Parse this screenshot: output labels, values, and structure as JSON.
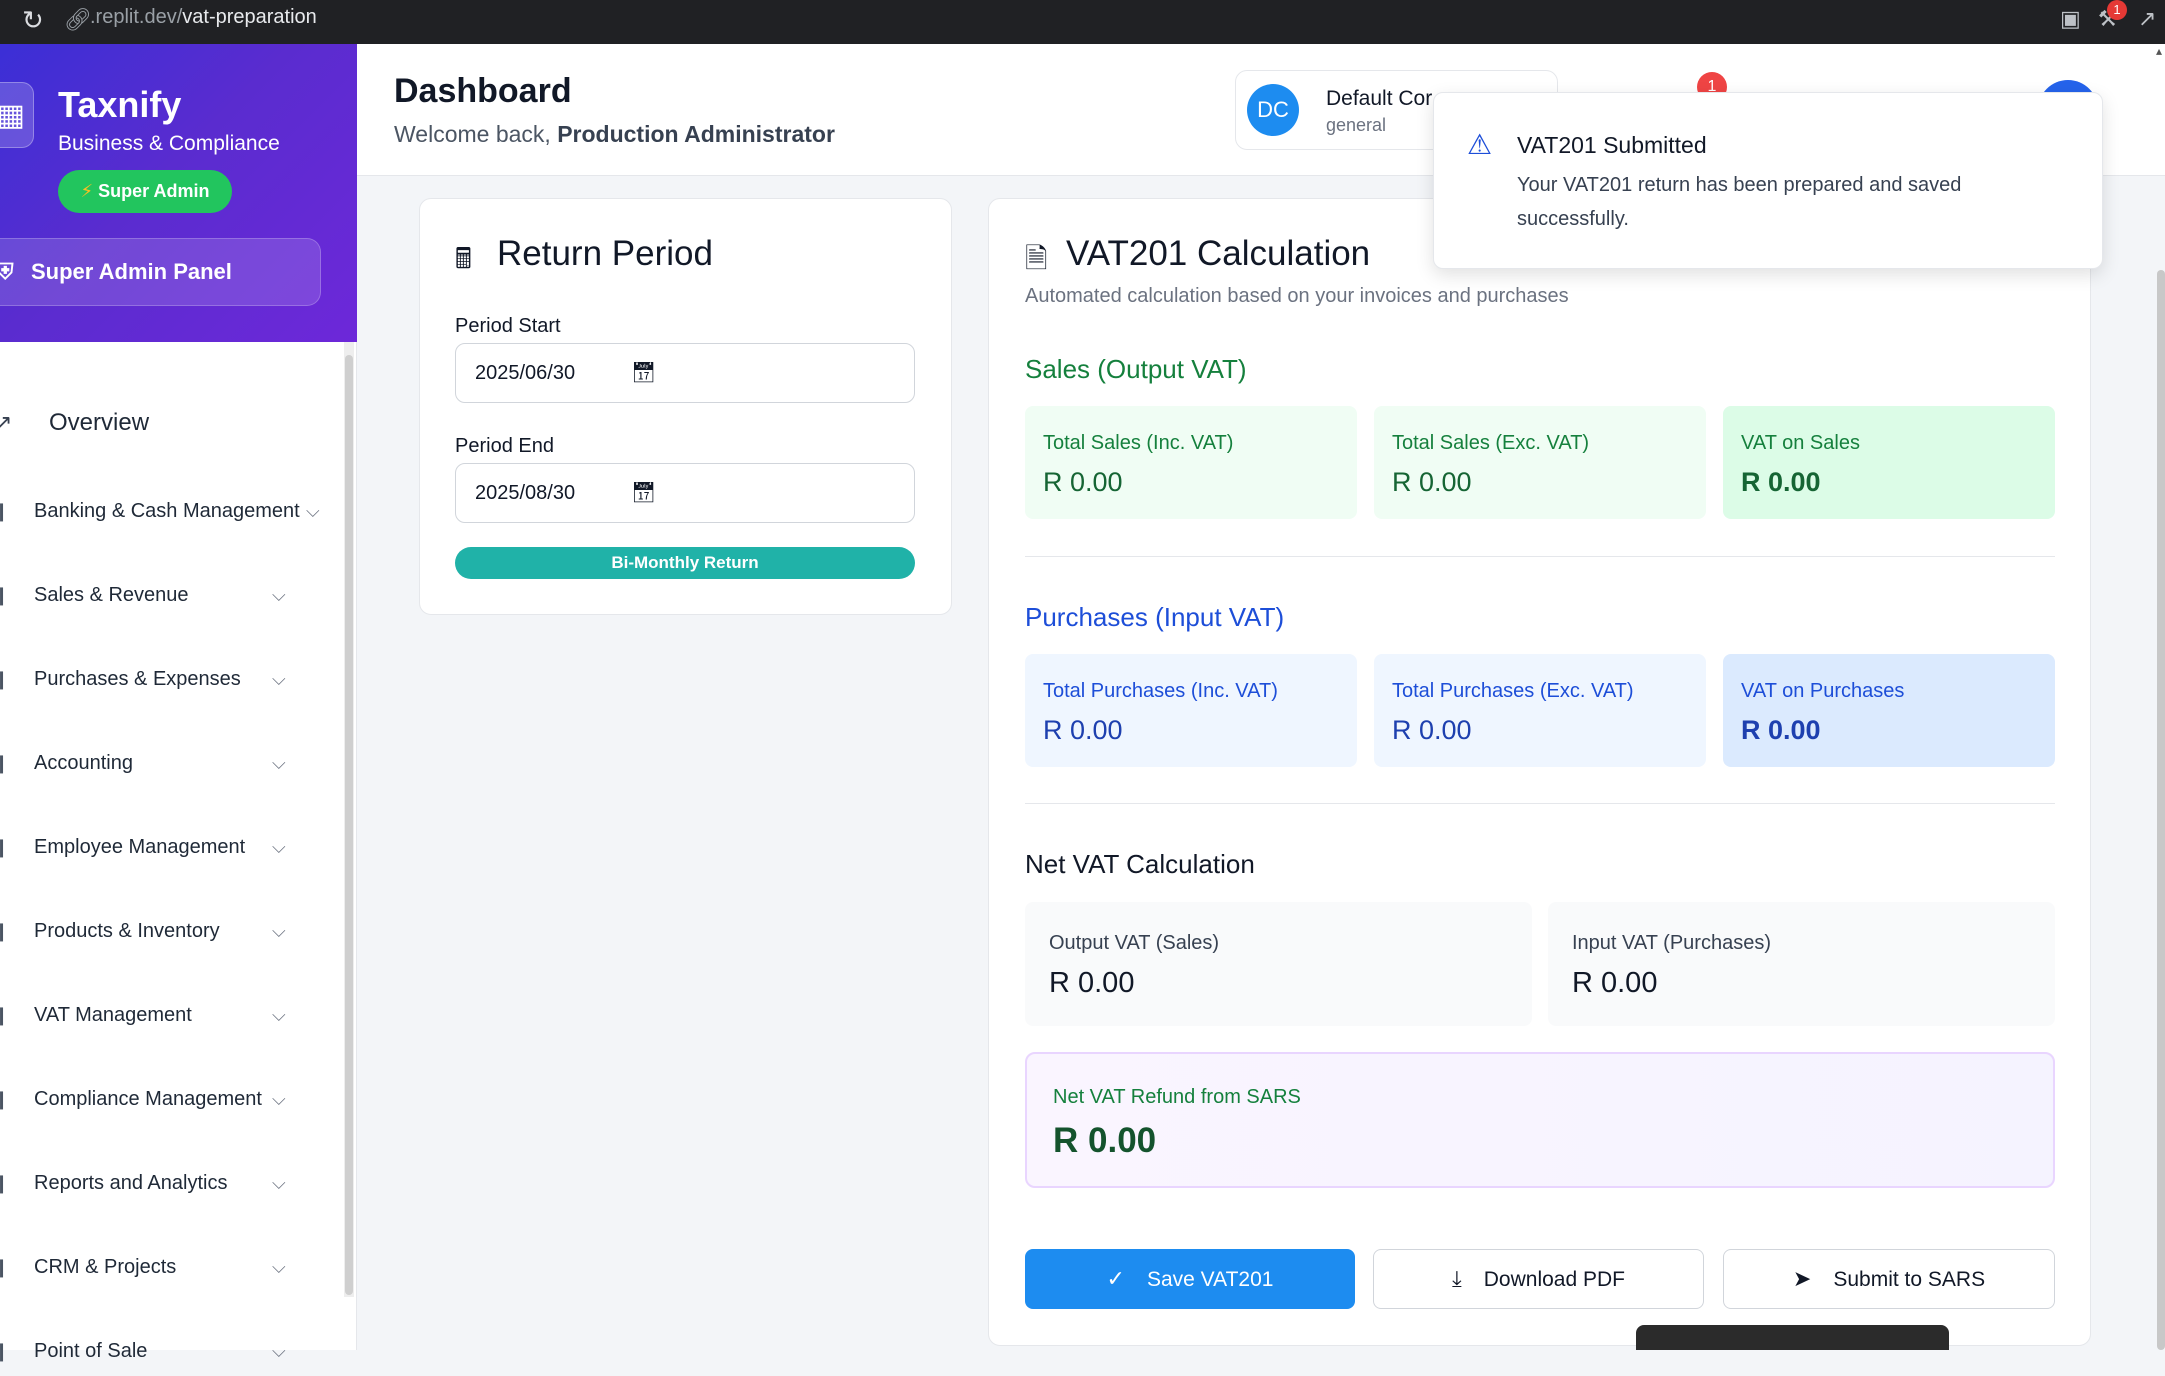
{
  "browser": {
    "url_domain": ".replit.dev/",
    "url_path": "vat-preparation",
    "badge_count": "1"
  },
  "sidebar": {
    "brand_title": "Taxnify",
    "brand_subtitle": "Business & Compliance",
    "role_badge": "Super Admin",
    "admin_panel": "Super Admin Panel",
    "overview": "Overview",
    "items": [
      {
        "label": "Banking & Cash Management"
      },
      {
        "label": "Sales & Revenue"
      },
      {
        "label": "Purchases & Expenses"
      },
      {
        "label": "Accounting"
      },
      {
        "label": "Employee Management"
      },
      {
        "label": "Products & Inventory"
      },
      {
        "label": "VAT Management"
      },
      {
        "label": "Compliance Management"
      },
      {
        "label": "Reports and Analytics"
      },
      {
        "label": "CRM & Projects"
      },
      {
        "label": "Point of Sale"
      }
    ]
  },
  "header": {
    "title": "Dashboard",
    "welcome_prefix": "Welcome back, ",
    "user_name": "Production Administrator",
    "company_initials": "DC",
    "company_name": "Default Cor",
    "company_type": "general",
    "notification_count": "1"
  },
  "period": {
    "title": "Return Period",
    "start_label": "Period Start",
    "start_value": "2025/06/30",
    "end_label": "Period End",
    "end_value": "2025/08/30",
    "frequency_badge": "Bi-Monthly Return"
  },
  "vat": {
    "title": "VAT201 Calculation",
    "subtitle": "Automated calculation based on your invoices and purchases",
    "sales_title": "Sales (Output VAT)",
    "sales": [
      {
        "label": "Total Sales (Inc. VAT)",
        "value": "R 0.00"
      },
      {
        "label": "Total Sales (Exc. VAT)",
        "value": "R 0.00"
      },
      {
        "label": "VAT on Sales",
        "value": "R 0.00"
      }
    ],
    "purchases_title": "Purchases (Input VAT)",
    "purchases": [
      {
        "label": "Total Purchases (Inc. VAT)",
        "value": "R 0.00"
      },
      {
        "label": "Total Purchases (Exc. VAT)",
        "value": "R 0.00"
      },
      {
        "label": "VAT on Purchases",
        "value": "R 0.00"
      }
    ],
    "net_title": "Net VAT Calculation",
    "output_vat_label": "Output VAT (Sales)",
    "output_vat_value": "R 0.00",
    "input_vat_label": "Input VAT (Purchases)",
    "input_vat_value": "R 0.00",
    "refund_label": "Net VAT Refund from SARS",
    "refund_value": "R 0.00",
    "save_button": "Save VAT201",
    "download_button": "Download PDF",
    "submit_button": "Submit to SARS"
  },
  "toast": {
    "title": "VAT201 Submitted",
    "message": "Your VAT201 return has been prepared and saved successfully."
  }
}
